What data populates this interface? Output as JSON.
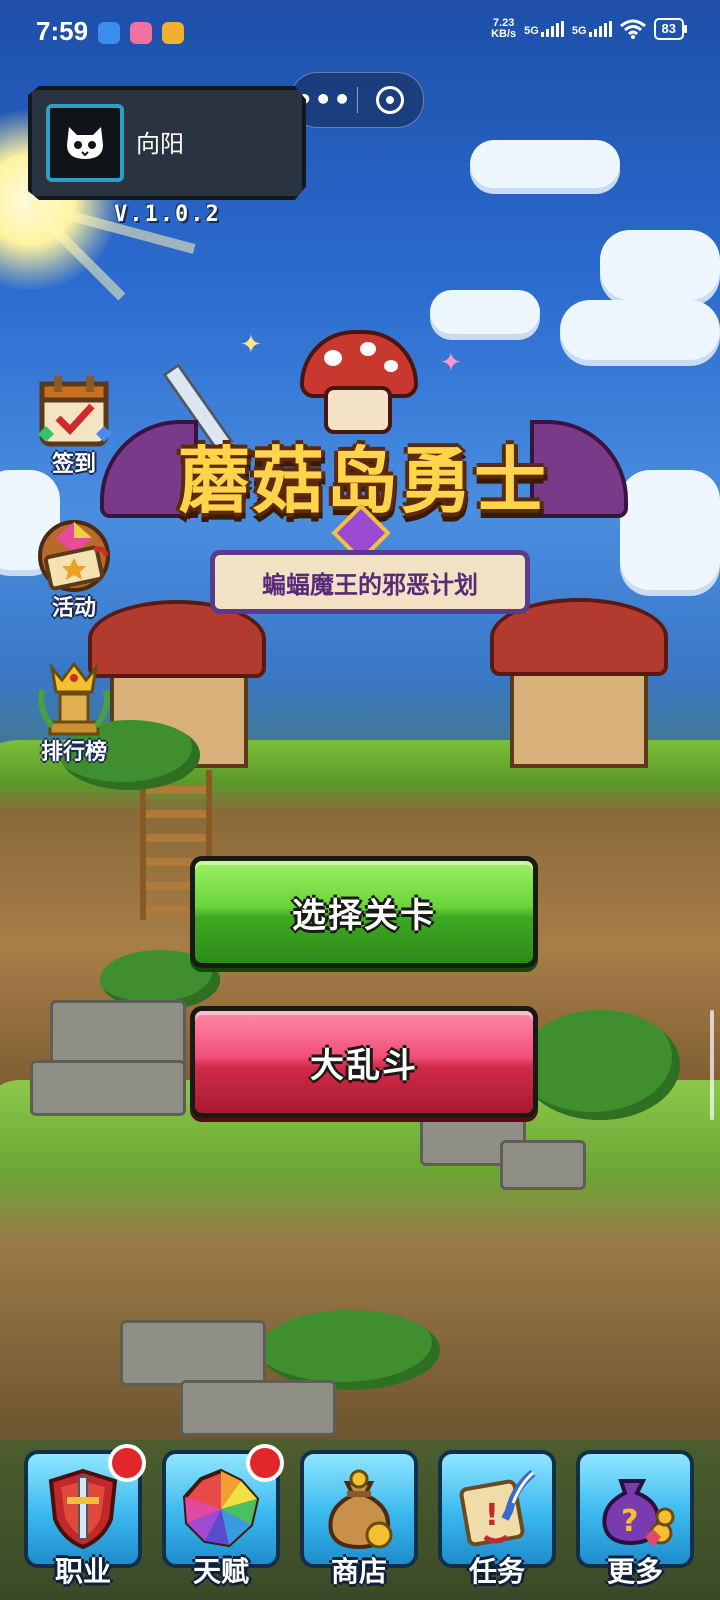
{
  "status_bar": {
    "time": "7:59",
    "net_speed_value": "7.23",
    "net_speed_unit": "KB/s",
    "signal_1": "5G",
    "signal_2": "5G",
    "battery": "83"
  },
  "capsule": {
    "more_label": "•••",
    "more_icon": "more-dots-icon",
    "close_icon": "target-close-icon"
  },
  "profile": {
    "name": "向阳",
    "avatar_icon": "skull-cat-icon",
    "version": "V.1.0.2"
  },
  "side_menu": [
    {
      "label": "签到",
      "icon": "calendar-check-icon"
    },
    {
      "label": "活动",
      "icon": "gem-ticket-icon"
    },
    {
      "label": "排行榜",
      "icon": "crown-trophy-icon"
    }
  ],
  "logo": {
    "title": "蘑菇岛勇士",
    "subtitle": "蝙蝠魔王的邪恶计划"
  },
  "actions": {
    "select_level": "选择关卡",
    "brawl": "大乱斗"
  },
  "bottom_nav": [
    {
      "label": "职业",
      "icon": "shield-sword-icon",
      "has_badge": true
    },
    {
      "label": "天赋",
      "icon": "rainbow-gem-icon",
      "has_badge": true
    },
    {
      "label": "商店",
      "icon": "coin-bag-icon",
      "has_badge": false
    },
    {
      "label": "任务",
      "icon": "scroll-quill-icon",
      "has_badge": false
    },
    {
      "label": "更多",
      "icon": "mystery-bag-icon",
      "has_badge": false
    }
  ],
  "colors": {
    "accent_green": "#6ad43a",
    "accent_red": "#d22a48",
    "logo_gold": "#ffd34a",
    "badge_red": "#e0282a",
    "nav_tile_blue": "#3ab8ee"
  }
}
